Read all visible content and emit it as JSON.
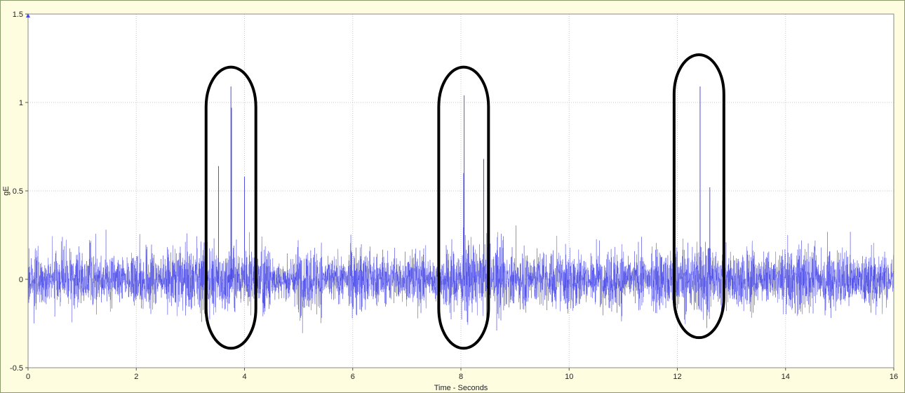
{
  "colors": {
    "background": "#fffde0",
    "plot_background": "#ffffff",
    "series": "#4a4ae6",
    "grid": "#c8c8c8",
    "highlight_ellipse": "#000000"
  },
  "chart_data": {
    "type": "line",
    "title": "",
    "xlabel": "Time - Seconds",
    "ylabel": "gE",
    "xlim": [
      0,
      16
    ],
    "ylim": [
      -0.5,
      1.5
    ],
    "x_ticks": [
      {
        "value": 0,
        "label": "0"
      },
      {
        "value": 2,
        "label": "2"
      },
      {
        "value": 4,
        "label": "4"
      },
      {
        "value": 6,
        "label": "6"
      },
      {
        "value": 8,
        "label": "8"
      },
      {
        "value": 10,
        "label": "10"
      },
      {
        "value": 12,
        "label": "12"
      },
      {
        "value": 14,
        "label": "14"
      },
      {
        "value": 16,
        "label": "16"
      }
    ],
    "y_ticks": [
      {
        "value": -0.5,
        "label": "-0.5"
      },
      {
        "value": 0,
        "label": "0"
      },
      {
        "value": 0.5,
        "label": "0.5"
      },
      {
        "value": 1,
        "label": "1"
      },
      {
        "value": 1.5,
        "label": "1.5"
      }
    ],
    "grid": true,
    "legend": "none",
    "series": [
      {
        "noise_amplitude": 0.12,
        "baseline": 0,
        "peaks": [
          {
            "x": 3.52,
            "y": 0.64
          },
          {
            "x": 3.75,
            "y": 1.09
          },
          {
            "x": 3.76,
            "y": 0.97
          },
          {
            "x": 4.0,
            "y": 0.58
          },
          {
            "x": 8.06,
            "y": 1.04
          },
          {
            "x": 8.05,
            "y": 0.6
          },
          {
            "x": 8.42,
            "y": 0.68
          },
          {
            "x": 12.42,
            "y": 1.09
          },
          {
            "x": 12.6,
            "y": 0.52
          }
        ]
      }
    ],
    "annotations": [
      {
        "type": "ellipse",
        "x_center": 3.75,
        "x_halfwidth": 0.46,
        "y_top": 1.2,
        "y_bottom": -0.39
      },
      {
        "type": "ellipse",
        "x_center": 8.05,
        "x_halfwidth": 0.46,
        "y_top": 1.2,
        "y_bottom": -0.39
      },
      {
        "type": "ellipse",
        "x_center": 12.4,
        "x_halfwidth": 0.46,
        "y_top": 1.27,
        "y_bottom": -0.33
      }
    ]
  }
}
